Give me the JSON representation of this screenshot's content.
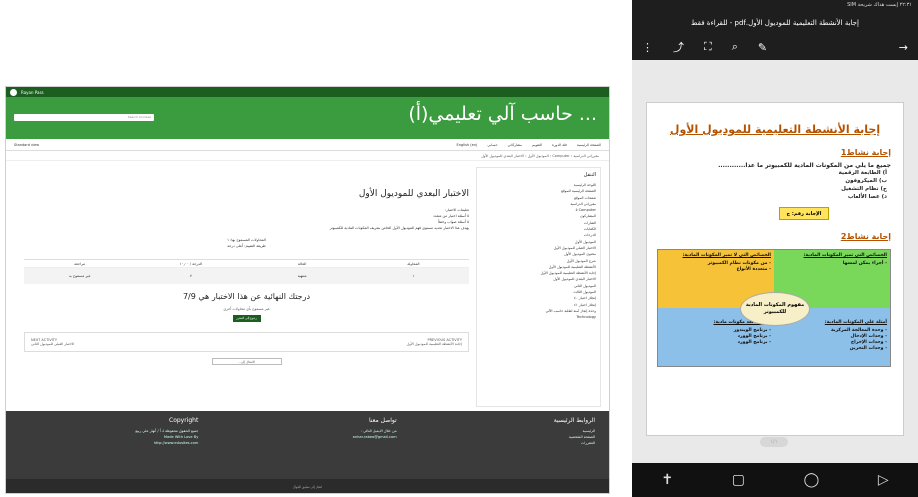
{
  "desktop": {
    "browser_tab": "Rayan Pass",
    "site_title": "حاسب آلي تعليمي(أ) ...",
    "search_placeholder": "Search Courses",
    "menu": [
      "الصفحة الرئيسية",
      "فئة الدورة",
      "التقويم",
      "مشاركاتي",
      "حسابي",
      "English (en)"
    ],
    "menu_left": "Standard view",
    "breadcrumb": "مقرراتي الدراسية ‹ Computer ‹ الموديول الأول ‹ الاختبار البعدي للموديول الأول",
    "sidebar": {
      "title": "التنقل",
      "items": [
        "اللوحة الرئيسية",
        "الصفحة الرئيسية للموقع",
        "صفحات الموقع",
        "مقرراتي الدراسية",
        "Computer ٥",
        "المشاركون",
        "الشارات",
        "الكفايات",
        "الدرجات",
        "الموديول الأول",
        "الاختبار القبلي للموديول الأول",
        "محتوى الموديول الأول",
        "شرح الموديول الأول",
        "الأنشطة التعليمية للموديول الأول",
        "إجابة الأنشطة التعليمية للموديول الأول",
        "الاختبار البعدي للموديول الأول",
        "الموديول الثاني",
        "الموديول الثالث",
        "إنجلاز اجتياز ٤٠",
        "إنجلاز اجتياز ٤١",
        "وحدة إنجاز آمنة لطلبة حاسب الآلي",
        "Technology"
      ]
    },
    "quiz": {
      "title": "الاختبار البعدي للموديول الأول",
      "meta_head": "تعليمات الاختبار:",
      "meta": [
        "٥ أسئلة اختيار من متعدد",
        "٥ أسئلة صواب وخطأ"
      ],
      "desc": "يهدف هذا الاختبار تحديد مستوى فهم الموديول الأول الخاص بتعريف المكونات المادية للكمبيوتر",
      "attempts_allowed": "المحاولات المسموح بها: ١",
      "grading": "طريقة التقييم: أعلى درجة",
      "table_headers": [
        "المحاولة",
        "الحالة",
        "الدرجة / ١٠٫٠٠",
        "مراجعة"
      ],
      "table_row": [
        "١",
        "منتهية",
        "٧",
        "غير مسموح به"
      ],
      "final_grade": "درجتك النهائية عن هذا الاختبار هي 7/9",
      "no_more": "غير مسموح بأي محاولات أخرى",
      "back_button": "رجوع إلى المقرر",
      "prev_activity_label": "PREVIOUS ACTIVITY",
      "prev_activity": "إجابة الأنشطة التعليمية للموديول الأول",
      "next_activity_label": "NEXT ACTIVITY",
      "next_activity": "الاختبار القبلي للموديول الثاني",
      "jump_to": "الانتقال إلى..."
    },
    "footer": {
      "links_title": "الروابط الرئيسية",
      "links": [
        "الرئيسية",
        "الصفحة الشخصية",
        "المقررات"
      ],
      "contact_title": "تواصل معنا",
      "contact": [
        "من خلال الايميل التالي :",
        "anhar.rabea@gmail.com"
      ],
      "copyright_title": "Copyright",
      "copyright": [
        "جميع الحقوق محفوظة لـ أ / أنهار علي ربيع",
        "Made With Love By",
        "http://www.edusites.com"
      ],
      "bottom": "انتقل إلى تطبيق الجوال"
    }
  },
  "phone": {
    "status": "٢٢:٣١ إيست هداك شريحة SIM",
    "title": "إجابة الأنشطة التعليمية للموديول الأول.pdf - للقراءة فقط",
    "doc_title": "إجابة الأنشطة التعليمية للموديول الأول",
    "act1": "إجابة نشاط1",
    "q1": "جميع ما يلي من المكونات المادية للكمبيوتر ما عدا............",
    "options": [
      "أ) الطابعة الرقمية",
      "ب) الميكروفون",
      "ج) نظام التشغيل",
      "د) عصا الألعاب"
    ],
    "answer": "الإجابة رقم: ج",
    "act2": "إجابة نشاط2",
    "grid": {
      "tr_title": "الخصائص التي تميز المكونات المادية:",
      "tr_items": [
        "- أجزاء يمكن لمسها"
      ],
      "tl_title": "الخصائص التي لا تميز المكونات المادية:",
      "tl_items": [
        "- من مكونات نظام الكمبيوتر",
        "- متعددة الأنواع"
      ],
      "br_title": "أمثلة على المكونات المادية:",
      "br_items": [
        "- وحدة المعالجة المركزية",
        "- وحدات الإدخال",
        "- وحدات الإخراج",
        "- وحدات التخزين"
      ],
      "bl_title": "أمثلة لا تعد مكونات مادية:",
      "bl_items": [
        "- برنامج الويندوز",
        "- برنامج الوورد",
        "- برنامج الوورد"
      ],
      "center": "مفهوم المكونات المادية للكمبيوتر"
    },
    "page_pill": "١/١"
  }
}
